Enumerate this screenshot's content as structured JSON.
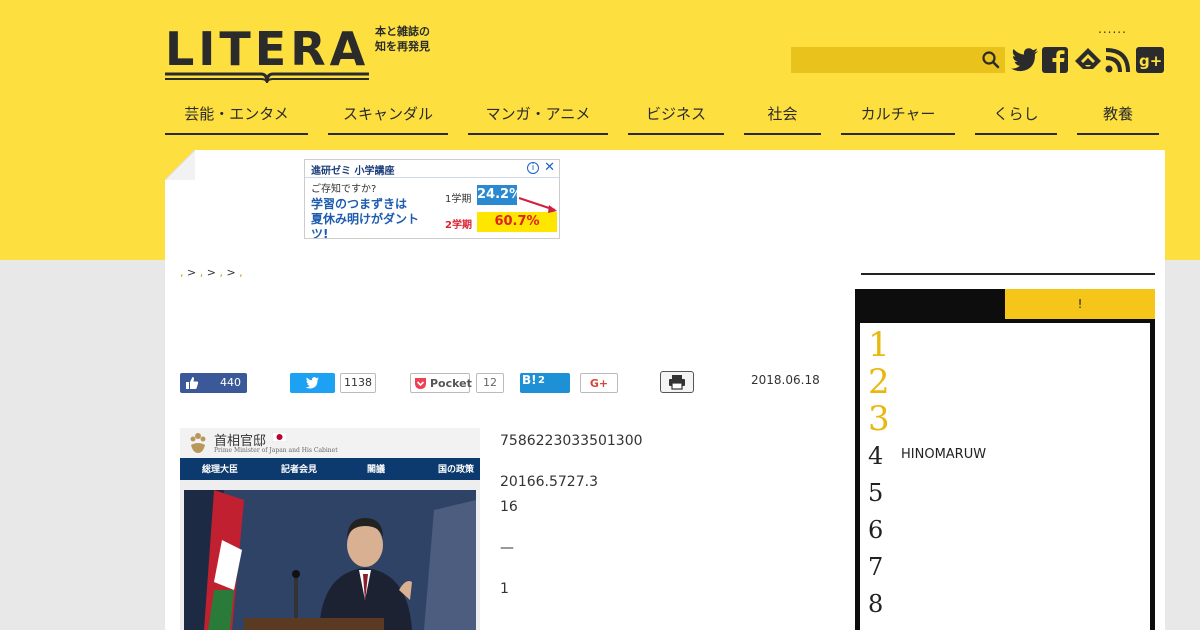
{
  "brand": {
    "logo": "LITERA",
    "tagline_1": "本と雑誌の",
    "tagline_2": "知を再発見"
  },
  "header": {
    "dots": "......",
    "search_placeholder": "",
    "social": [
      "twitter-icon",
      "facebook-icon",
      "feedly-icon",
      "rss-icon",
      "google-plus-icon"
    ]
  },
  "nav": [
    "芸能・エンタメ",
    "スキャンダル",
    "マンガ・アニメ",
    "ビジネス",
    "社会",
    "カルチャー",
    "くらし",
    "教養"
  ],
  "ad": {
    "header": "進研ゼミ 小学講座",
    "line1": "ご存知ですか?",
    "line2": "学習のつまずきは",
    "line3": "夏休み明けがダントツ!",
    "term1": "1学期",
    "value1": "24.2%",
    "term2": "2学期",
    "value2": "60.7%",
    "close": "✕",
    "info": "i"
  },
  "breadcrumb": {
    "sep1": "> ",
    "sep2": "> ",
    "sep3": "> "
  },
  "share": {
    "facebook_count": "440",
    "twitter_count": "1138",
    "pocket_label": "Pocket",
    "pocket_count": "12",
    "hatena_label": "B!",
    "hatena_count": "2",
    "gplus_label": "G+"
  },
  "article": {
    "date": "2018.06.18",
    "para1": "7586223033501300",
    "para2": "20166.5727.3",
    "para3": "16",
    "dash": "—",
    "para4": "1"
  },
  "photo": {
    "site_title": "首相官邸",
    "site_sub": "Prime Minister of Japan and His Cabinet",
    "nav": [
      "総理大臣",
      "記者会見",
      "閣議",
      "国の政策"
    ]
  },
  "ranking": {
    "tab2": "!",
    "numbers": [
      "1",
      "2",
      "3",
      "4",
      "5",
      "6",
      "7",
      "8"
    ],
    "item4_text": "HINOMARUW"
  },
  "colors": {
    "brand_yellow": "#fde040",
    "ranking_gold": "#e8b80e",
    "facebook": "#3b5998",
    "twitter": "#1da1f2",
    "hatena": "#1e90d6"
  }
}
